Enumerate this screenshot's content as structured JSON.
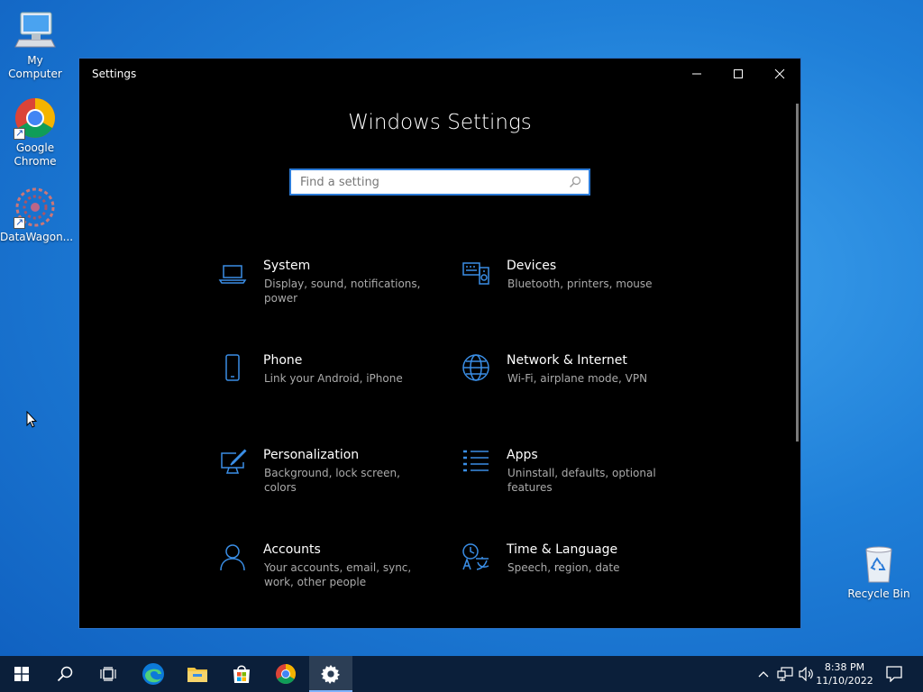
{
  "desktop": {
    "icons": [
      {
        "label": "My Computer",
        "icon": "computer-icon"
      },
      {
        "label": "Google Chrome",
        "icon": "chrome-icon"
      },
      {
        "label": "DataWagon...",
        "icon": "datawagon-icon"
      },
      {
        "label": "Recycle Bin",
        "icon": "recycle-bin-icon"
      }
    ]
  },
  "window": {
    "title": "Settings",
    "heading": "Windows Settings",
    "search_placeholder": "Find a setting",
    "categories": [
      {
        "name": "System",
        "desc": "Display, sound, notifications, power",
        "icon": "laptop-icon"
      },
      {
        "name": "Devices",
        "desc": "Bluetooth, printers, mouse",
        "icon": "keyboard-speaker-icon"
      },
      {
        "name": "Phone",
        "desc": "Link your Android, iPhone",
        "icon": "phone-icon"
      },
      {
        "name": "Network & Internet",
        "desc": "Wi-Fi, airplane mode, VPN",
        "icon": "globe-icon"
      },
      {
        "name": "Personalization",
        "desc": "Background, lock screen, colors",
        "icon": "paint-monitor-icon"
      },
      {
        "name": "Apps",
        "desc": "Uninstall, defaults, optional features",
        "icon": "apps-list-icon"
      },
      {
        "name": "Accounts",
        "desc": "Your accounts, email, sync, work, other people",
        "icon": "person-icon"
      },
      {
        "name": "Time & Language",
        "desc": "Speech, region, date",
        "icon": "time-language-icon"
      }
    ]
  },
  "taskbar": {
    "time": "8:38 PM",
    "date": "11/10/2022"
  },
  "colors": {
    "accent": "#2b7bd8",
    "icon_blue": "#3a8ee6",
    "taskbar": "#0b1f3a"
  }
}
